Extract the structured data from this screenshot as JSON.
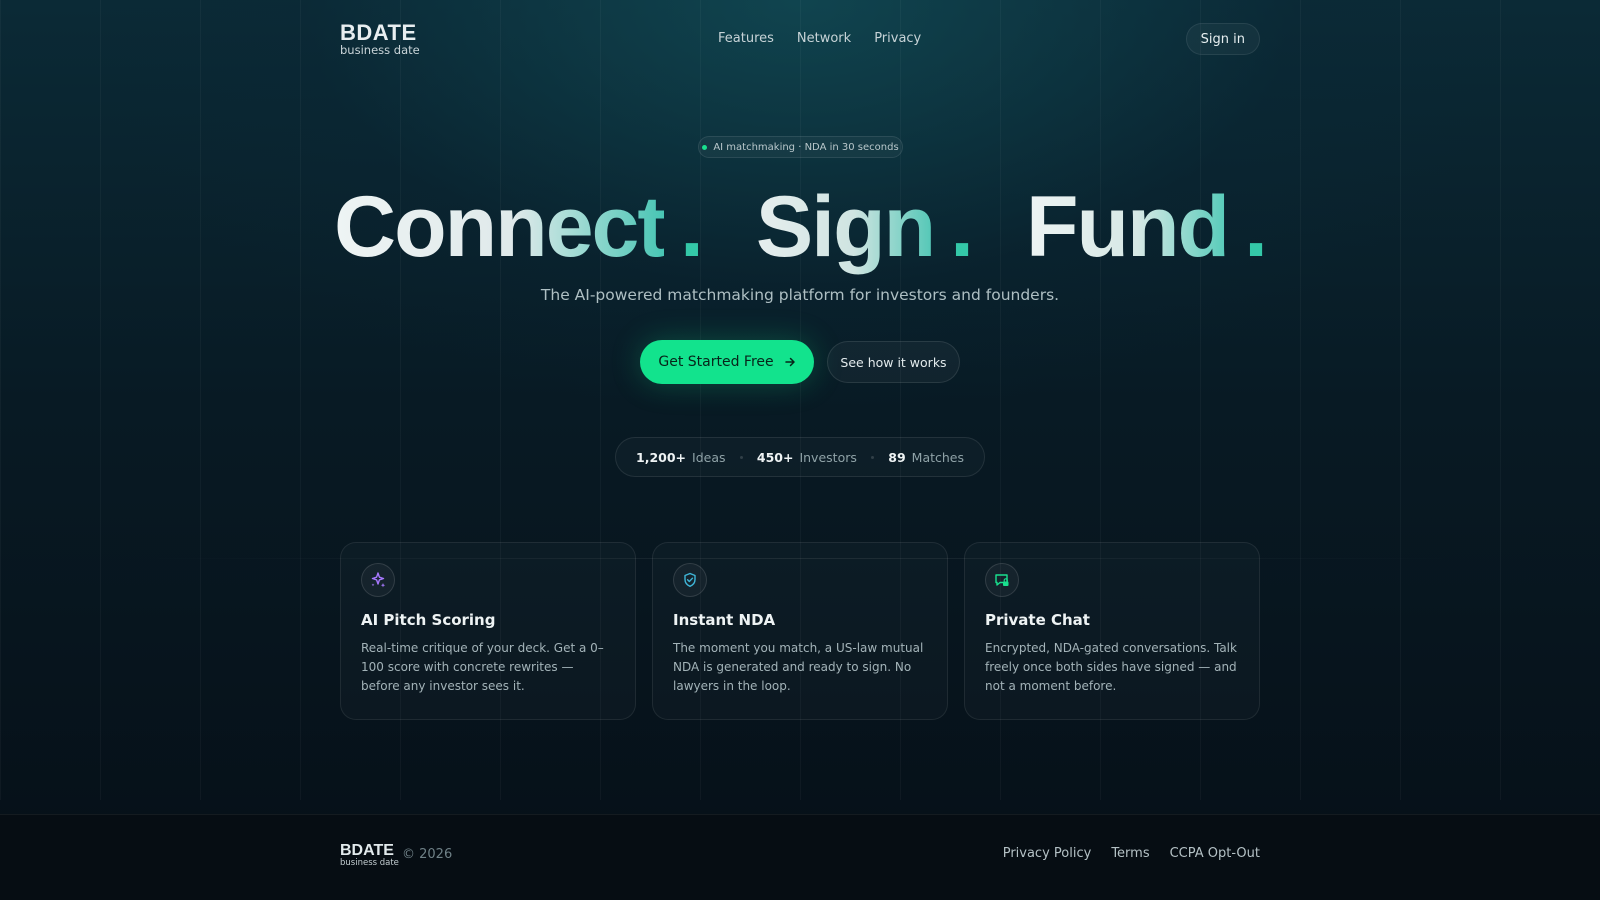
{
  "brand": {
    "name": "BDATE",
    "tagline": "business date"
  },
  "nav": {
    "items": [
      {
        "label": "Features"
      },
      {
        "label": "Network"
      },
      {
        "label": "Privacy"
      }
    ],
    "signin_label": "Sign in"
  },
  "hero": {
    "badge": "AI matchmaking · NDA in 30 seconds",
    "headline": {
      "word1": "Connect",
      "word2": "Sign",
      "word3": "Fund",
      "punct": "."
    },
    "subtitle": "The AI-powered matchmaking platform for investors and founders.",
    "cta_primary": "Get Started Free",
    "cta_primary_icon": "arrow-right-icon",
    "cta_secondary": "See how it works"
  },
  "stats": [
    {
      "value": "1,200+",
      "label": "Ideas"
    },
    {
      "value": "450+",
      "label": "Investors"
    },
    {
      "value": "89",
      "label": "Matches"
    }
  ],
  "features": [
    {
      "icon": "sparkles-icon",
      "icon_color": "#a879ff",
      "title": "AI Pitch Scoring",
      "body": "Real-time critique of your deck. Get a 0–100 score with concrete rewrites — before any investor sees it."
    },
    {
      "icon": "shield-check-icon",
      "icon_color": "#3fb6d8",
      "title": "Instant NDA",
      "body": "The moment you match, a US-law mutual NDA is generated and ready to sign. No lawyers in the loop."
    },
    {
      "icon": "chat-lock-icon",
      "icon_color": "#19e08e",
      "title": "Private Chat",
      "body": "Encrypted, NDA-gated conversations. Talk freely once both sides have signed — and not a moment before."
    }
  ],
  "footer": {
    "brand": "BDATE",
    "tagline": "business date",
    "copyright": "© 2026",
    "links": [
      {
        "label": "Privacy Policy"
      },
      {
        "label": "Terms"
      },
      {
        "label": "CCPA Opt-Out"
      }
    ]
  },
  "colors": {
    "accent": "#12e38d",
    "background": "#081a24"
  }
}
